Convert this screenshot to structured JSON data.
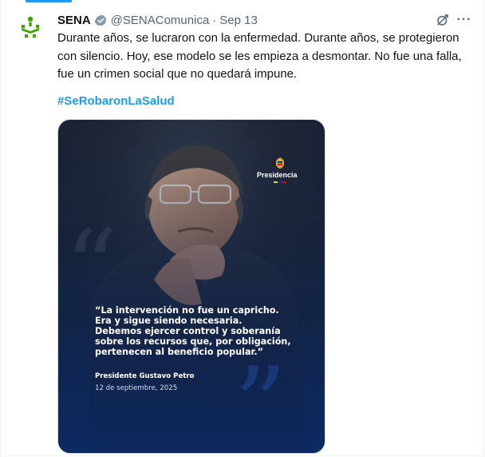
{
  "tweet": {
    "author_name": "SENA",
    "handle": "@SENAComunica",
    "separator": "·",
    "date": "Sep 13",
    "text": "Durante años, se lucraron con la enfermedad. Durante años, se protegieron con silencio. Hoy, ese modelo se les empieza a desmontar. No fue una falla, fue un crimen social que no quedará impune.",
    "hashtag": "#SeRobaronLaSalud",
    "more_label": "···",
    "icons": {
      "avatar": "sena-logo-icon",
      "verified": "verified-badge-icon",
      "grok": "grok-icon",
      "more": "more-icon"
    }
  },
  "media": {
    "brand_label": "Presidencia",
    "quote": "“La intervención no fue un capricho.\nEra y sigue siendo necesaria.\nDebemos ejercer control y soberanía\nsobre los recursos que, por obligación,\npertenecen al beneficio popular.”",
    "author": "Presidente Gustavo Petro",
    "date": "12 de septiembre, 2025",
    "colors": {
      "flag_yellow": "#fcd116",
      "flag_blue": "#003893",
      "flag_red": "#ce1126"
    }
  },
  "colors": {
    "accent": "#1d9bf0",
    "text": "#0f1419",
    "muted": "#536471",
    "sena_green": "#39a900"
  }
}
